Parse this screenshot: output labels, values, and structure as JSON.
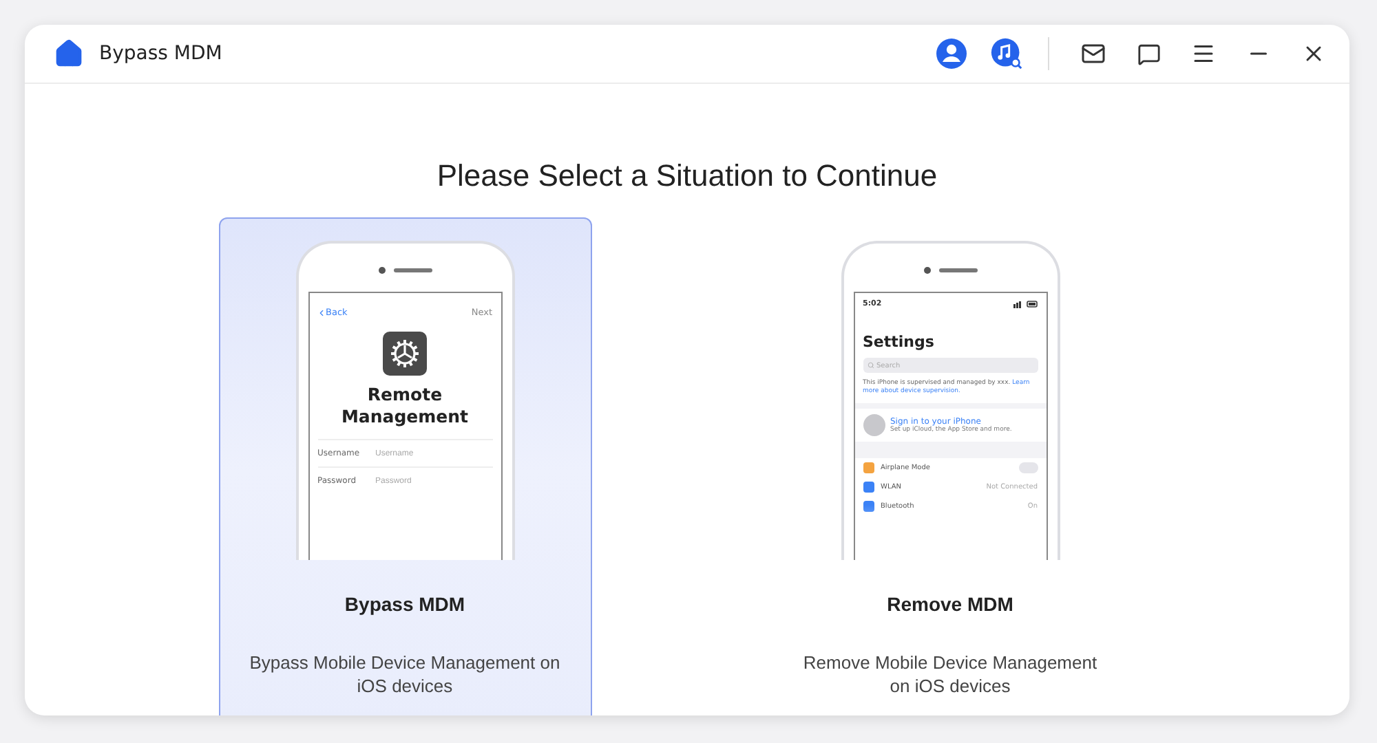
{
  "window": {
    "title": "Bypass MDM"
  },
  "heading": "Please Select a Situation to Continue",
  "options": [
    {
      "kind": "login",
      "selected": true,
      "title": "Bypass MDM",
      "description": [
        "Bypass Mobile Device Management on",
        "iOS devices"
      ],
      "screen": {
        "back": "Back",
        "next": "Next",
        "title": "Remote Management",
        "fields": [
          {
            "label": "Username",
            "placeholder": "Username"
          },
          {
            "label": "Password",
            "placeholder": "Password"
          }
        ]
      }
    },
    {
      "kind": "settings",
      "selected": false,
      "title": "Remove MDM",
      "description": [
        "Remove Mobile Device Management",
        "on iOS devices"
      ],
      "screen": {
        "time": "5:02",
        "title": "Settings",
        "search": "Search",
        "notice": "This iPhone is supervised and managed by xxx.",
        "link": "Learn more about device supervision.",
        "account": "Sign in to your iPhone",
        "account_sub": "Set up iCloud, the App Store and more.",
        "rows": [
          {
            "label": "Airplane Mode",
            "on": false,
            "color": "#f4a340"
          },
          {
            "label": "WLAN",
            "value": "Not Connected",
            "color": "#3b82f6"
          },
          {
            "label": "Bluetooth",
            "value": "On",
            "color": "#3b82f6"
          }
        ]
      }
    }
  ]
}
